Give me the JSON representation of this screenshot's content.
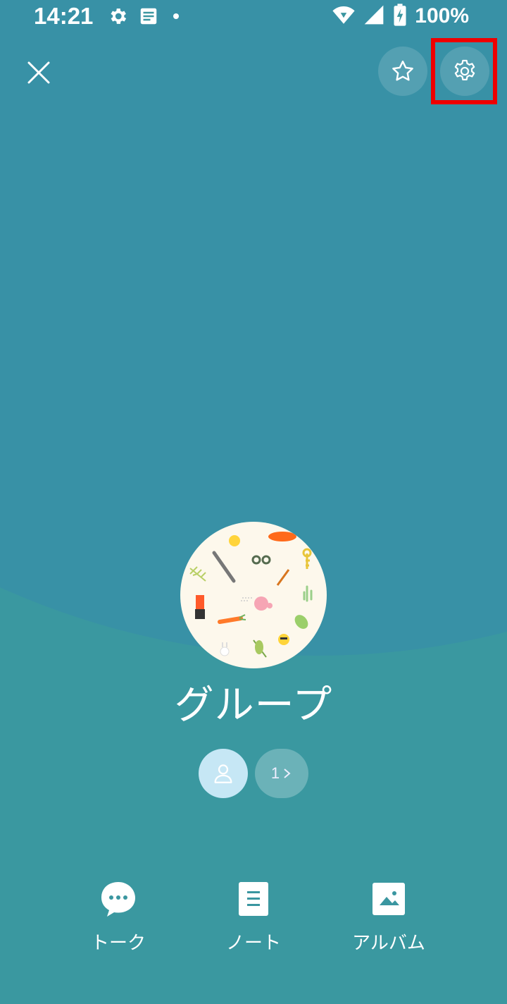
{
  "status_bar": {
    "time": "14:21",
    "battery": "100%"
  },
  "group": {
    "name": "グループ",
    "member_count_label": "1"
  },
  "tabs": [
    {
      "label": "トーク",
      "icon": "chat-bubble-icon"
    },
    {
      "label": "ノート",
      "icon": "note-icon"
    },
    {
      "label": "アルバム",
      "icon": "album-icon"
    }
  ],
  "colors": {
    "background": "#3891a6",
    "highlight": "#ee0000",
    "member_button": "#c6e7f5"
  }
}
